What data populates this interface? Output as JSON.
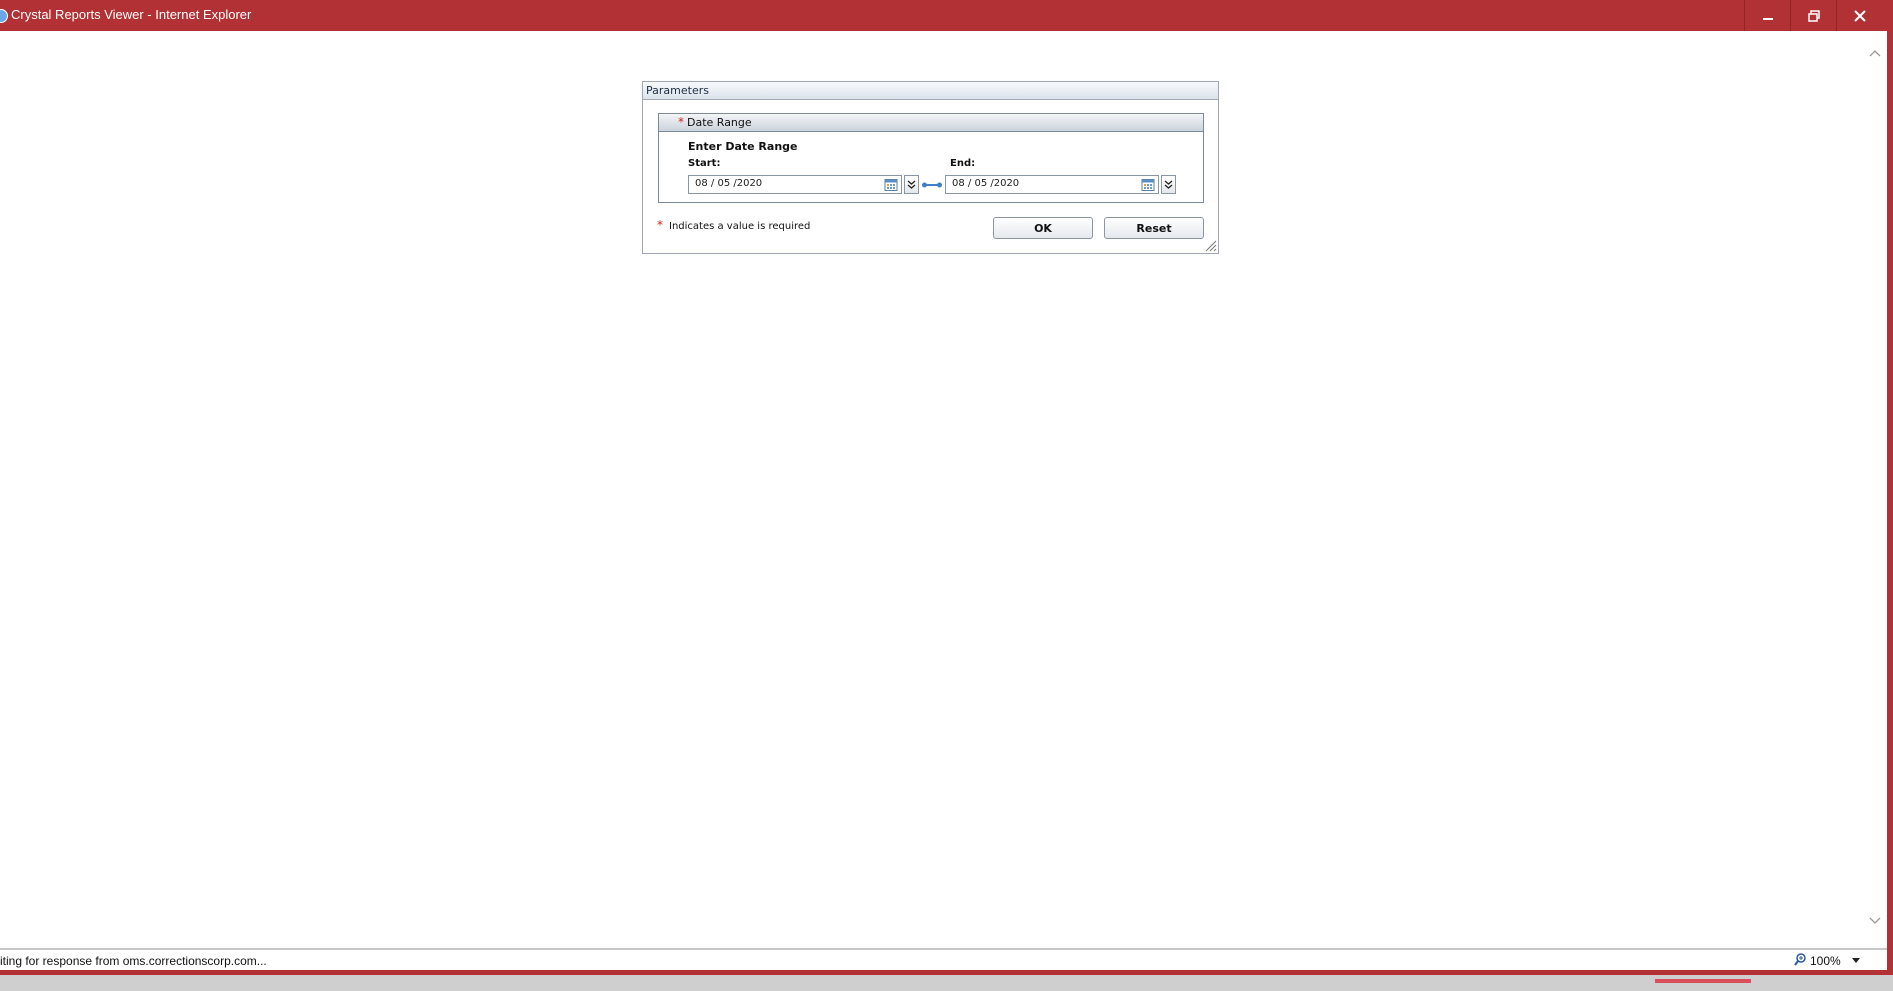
{
  "window": {
    "title": "Crystal Reports Viewer - Internet Explorer"
  },
  "parameters": {
    "header": "Parameters",
    "date_range": {
      "required_star": "*",
      "title": "Date Range",
      "prompt": "Enter Date Range",
      "start_label": "Start:",
      "start_value": "08 / 05 /2020",
      "end_label": "End:",
      "end_value": "08 / 05 /2020"
    },
    "required_note": {
      "star": "*",
      "text": "Indicates a value is required"
    },
    "buttons": {
      "ok": "OK",
      "reset": "Reset"
    }
  },
  "statusbar": {
    "text": "iting for response from oms.correctionscorp.com...",
    "zoom": "100%"
  },
  "colors": {
    "titlebar": "#b13135",
    "required": "#d42020",
    "progress": "#d94f5b"
  }
}
